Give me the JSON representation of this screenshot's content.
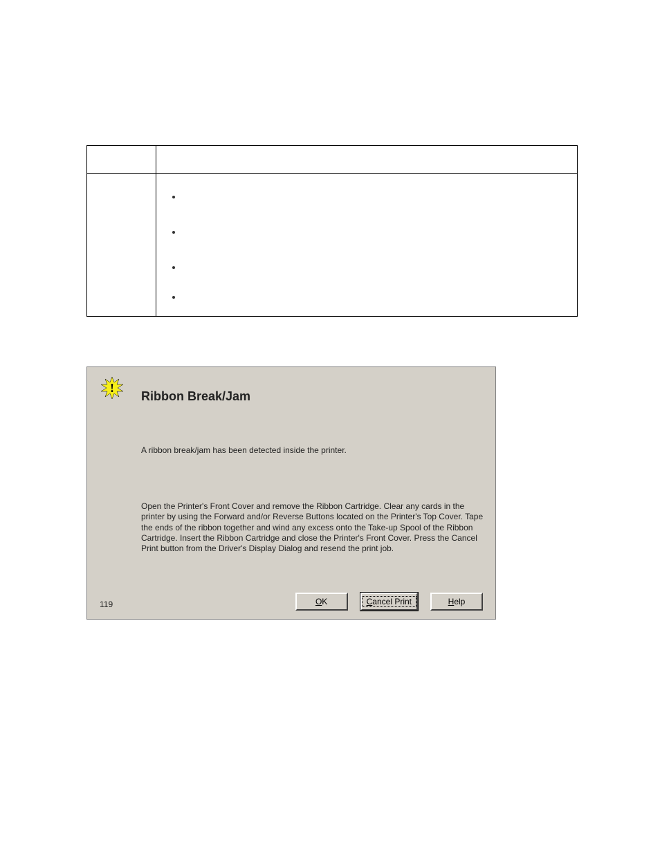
{
  "table": {
    "left_header": "",
    "right_header": "",
    "left_cell": "",
    "bullets": [
      "",
      "",
      "",
      ""
    ]
  },
  "dialog": {
    "title": "Ribbon Break/Jam",
    "message": "A ribbon break/jam has been detected inside the printer.",
    "instructions": "Open the Printer's Front Cover and remove the Ribbon Cartridge. Clear any cards in the printer by using the Forward and/or Reverse Buttons located on the Printer's Top Cover. Tape the ends of the ribbon together and wind any excess onto the Take-up Spool of the Ribbon Cartridge. Insert the Ribbon Cartridge and close the Printer's Front Cover. Press the Cancel Print button from the Driver's Display Dialog and resend the print job.",
    "code": "119",
    "buttons": {
      "ok": "OK",
      "cancel": "Cancel Print",
      "help": "Help"
    },
    "icon": "warning-starburst"
  }
}
